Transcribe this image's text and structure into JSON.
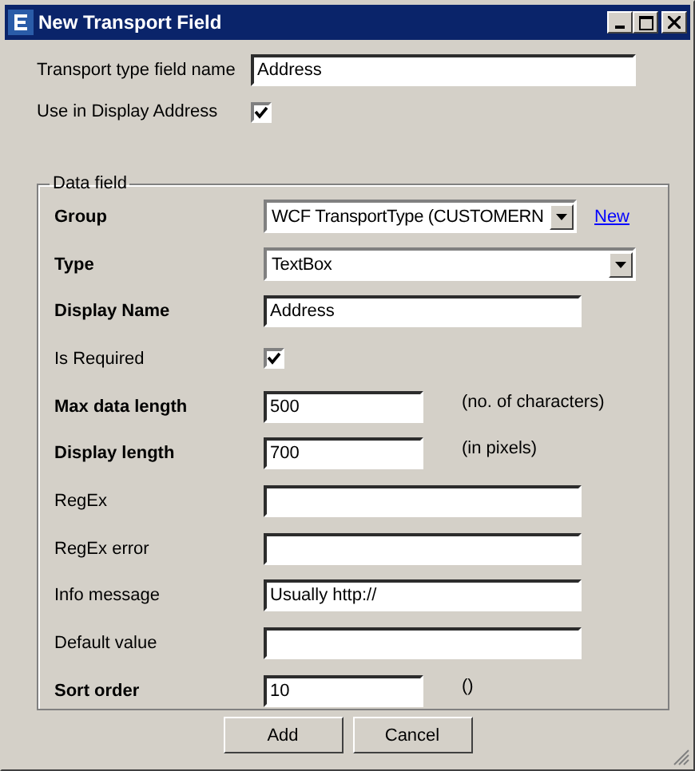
{
  "window": {
    "title": "New Transport Field"
  },
  "top_fields": [
    {
      "kind": "text",
      "label": "Transport type field name",
      "value": "Address"
    },
    {
      "kind": "checkbox",
      "label": "Use in Display Address",
      "checked": true
    }
  ],
  "data_field": {
    "title": "Data field",
    "rows": [
      {
        "kind": "select",
        "label": "Group",
        "bold": true,
        "value": "WCF TransportType (CUSTOMERN",
        "link": "New"
      },
      {
        "kind": "select",
        "label": "Type",
        "bold": true,
        "value": "TextBox"
      },
      {
        "kind": "text",
        "label": "Display Name",
        "bold": true,
        "value": "Address"
      },
      {
        "kind": "checkbox",
        "label": "Is Required",
        "bold": false,
        "checked": true
      },
      {
        "kind": "text",
        "label": "Max data length",
        "bold": true,
        "value": "500",
        "hint": "(no. of characters)"
      },
      {
        "kind": "text",
        "label": "Display length",
        "bold": true,
        "value": "700",
        "hint": "(in pixels)"
      },
      {
        "kind": "text",
        "label": "RegEx",
        "bold": false
      },
      {
        "kind": "text",
        "label": "RegEx error",
        "bold": false
      },
      {
        "kind": "text",
        "label": "Info message",
        "bold": false,
        "value": "Usually http://"
      },
      {
        "kind": "text",
        "label": "Default value",
        "bold": false
      },
      {
        "kind": "text",
        "label": "Sort order",
        "bold": true,
        "value": "10",
        "hint": "()"
      }
    ]
  },
  "buttons": [
    "Add",
    "Cancel"
  ]
}
